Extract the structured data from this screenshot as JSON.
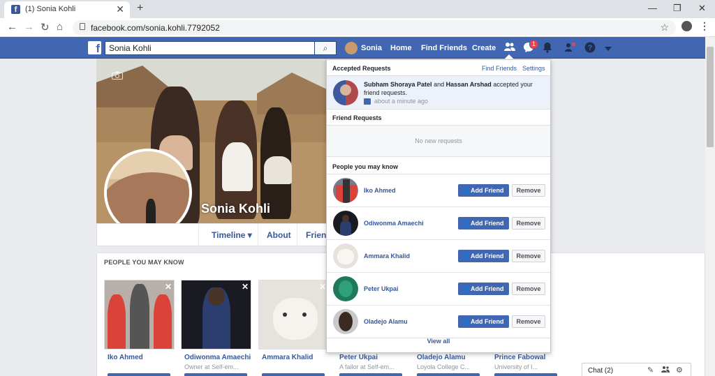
{
  "browser": {
    "tab_title": "(1) Sonia Kohli",
    "tab_favicon": "f",
    "url": "facebook.com/sonia.kohli.7792052",
    "new_tab": "+",
    "close_tab": "✕",
    "win_min": "—",
    "win_max": "❐",
    "win_close": "✕",
    "back": "←",
    "forward": "→",
    "reload": "↻",
    "home": "⌂",
    "star": "☆",
    "menu": "⋮"
  },
  "fb_header": {
    "logo": "f",
    "search_value": "Sonia Kohli",
    "search_icon": "⌕",
    "user_name": "Sonia",
    "nav": [
      "Home",
      "Find Friends",
      "Create"
    ],
    "messages_badge": "1",
    "friend_requests_icon": "friends-icon",
    "messages_icon": "messenger-icon",
    "notifications_icon": "bell-icon",
    "quick_help_icon": "help-icon",
    "dropdown_icon": "caret-down-icon"
  },
  "profile": {
    "name": "Sonia Kohli",
    "tabs": [
      "Timeline ▾",
      "About",
      "Friends"
    ]
  },
  "pymk_panel": {
    "title": "PEOPLE YOU MAY KNOW",
    "cards": [
      {
        "name": "Iko Ahmed",
        "sub": ""
      },
      {
        "name": "Odiwonma Amaechi",
        "sub": "Owner at Self-em..."
      },
      {
        "name": "Ammara Khalid",
        "sub": ""
      },
      {
        "name": "Peter Ukpai",
        "sub": "A failor at Self-em..."
      },
      {
        "name": "Oladejo Alamu",
        "sub": "Loyola College C..."
      },
      {
        "name": "Prince Fabowal",
        "sub": "University of I..."
      }
    ]
  },
  "dropdown": {
    "accepted_title": "Accepted Requests",
    "find_friends": "Find Friends",
    "settings": "Settings",
    "accepted_name1": "Subham Shoraya Patel",
    "accepted_and": "and",
    "accepted_name2": "Hassan Arshad",
    "accepted_suffix": "accepted your friend requests.",
    "accepted_time": "about a minute ago",
    "friend_requests_title": "Friend Requests",
    "no_requests": "No new requests",
    "pymk_title": "People you may know",
    "add_friend": "Add Friend",
    "remove": "Remove",
    "people": [
      "Iko Ahmed",
      "Odiwonma Amaechi",
      "Ammara Khalid",
      "Peter Ukpai",
      "Oladejo Alamu"
    ],
    "view_all": "View all"
  },
  "chat": {
    "label": "Chat (2)"
  },
  "colors": {
    "fb_blue": "#4267b2",
    "link": "#365899",
    "badge_red": "#fa3e3e"
  }
}
